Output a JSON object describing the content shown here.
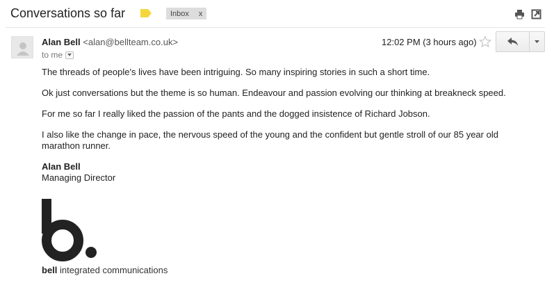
{
  "thread": {
    "subject": "Conversations so far",
    "label_chip": "Inbox",
    "label_chip_close": "x"
  },
  "message": {
    "sender_name": "Alan Bell",
    "sender_email": "<alan@bellteam.co.uk>",
    "to_text": "to me",
    "timestamp": "12:02 PM (3 hours ago)",
    "paragraphs": [
      "The threads of people's lives have been intriguing. So many inspiring stories in such a short time.",
      "Ok just conversations but the theme is so human. Endeavour and passion evolving our thinking at breakneck speed.",
      "For me so far I really liked the passion of the pants and the dogged insistence of Richard Jobson.",
      "I also like the change in pace, the nervous speed of the young and the confident but gentle stroll of our 85 year old marathon runner."
    ],
    "signature_name": "Alan Bell",
    "signature_title": "Managing Director",
    "company_bold": "bell",
    "company_rest": " integrated communications"
  },
  "icons": {
    "label_tag": "label-tag-icon",
    "print": "print-icon",
    "popout": "popout-icon",
    "avatar": "avatar-icon",
    "star": "star-icon",
    "reply": "reply-icon",
    "more": "chevron-down-icon"
  },
  "colors": {
    "label_tag": "#f5d63d",
    "chip_bg": "#dddddd",
    "logo": "#222222"
  }
}
